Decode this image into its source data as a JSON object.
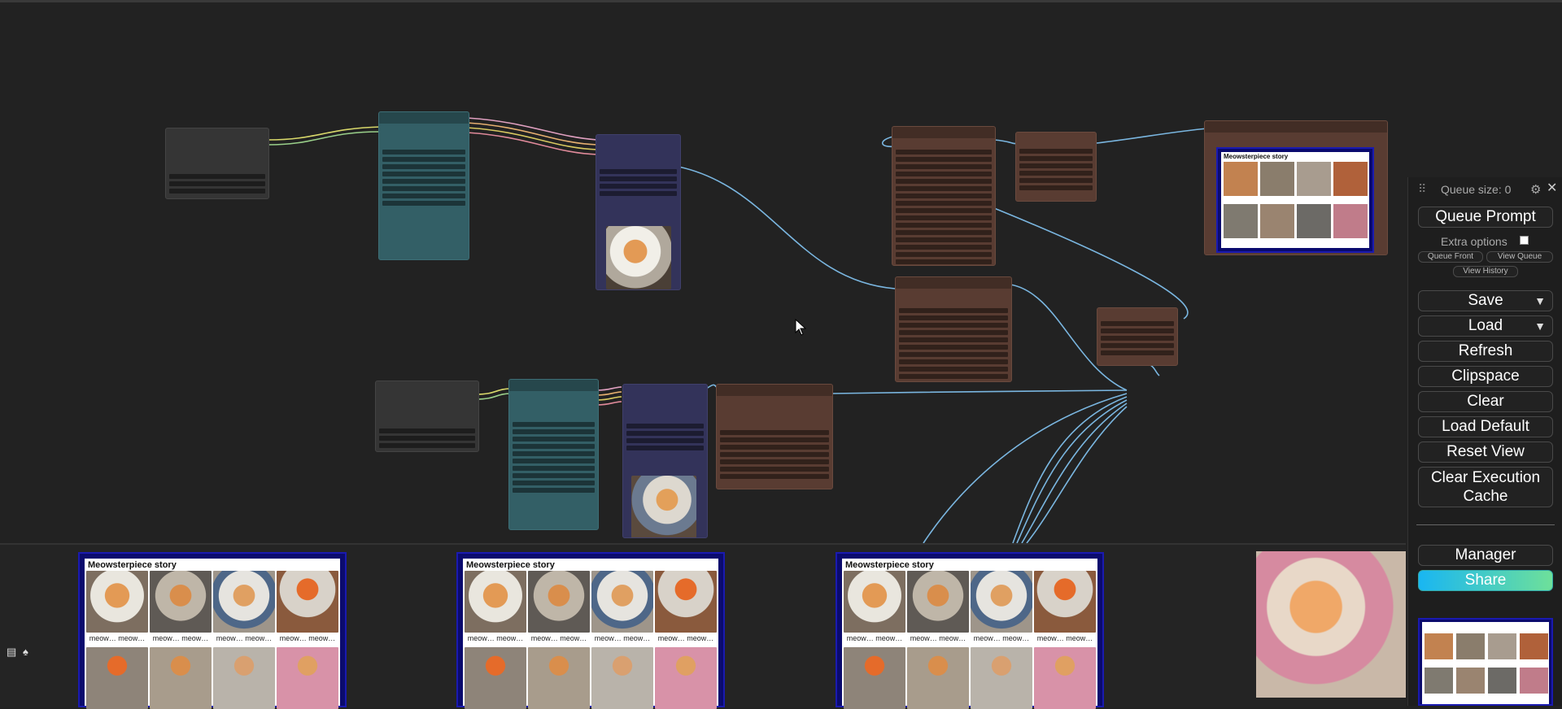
{
  "queue": {
    "size_label": "Queue size: 0",
    "extra_options_label": "Extra options",
    "extra_options_checked": false
  },
  "buttons": {
    "queue_prompt": "Queue Prompt",
    "queue_front": "Queue Front",
    "view_queue": "View Queue",
    "view_history": "View History",
    "save": "Save",
    "load": "Load",
    "refresh": "Refresh",
    "clipspace": "Clipspace",
    "clear": "Clear",
    "load_default": "Load Default",
    "reset_view": "Reset View",
    "clear_execution_cache": "Clear Execution Cache",
    "manager": "Manager",
    "share": "Share"
  },
  "gallery": {
    "cards": [
      {
        "title": "Meowsterpiece story",
        "captions": [
          "meow… meow…",
          "meow… meow…",
          "meow… meow…",
          "meow… meow…"
        ]
      },
      {
        "title": "Meowsterpiece story",
        "captions": [
          "meow… meow…",
          "meow… meow…",
          "meow… meow…",
          "meow… meow…"
        ]
      },
      {
        "title": "Meowsterpiece story",
        "captions": [
          "meow… meow…",
          "meow… meow…",
          "meow… meow…",
          "meow… meow…"
        ]
      }
    ]
  },
  "canvas_preview": {
    "title": "Meowsterpiece story"
  },
  "colors": {
    "background": "#222222",
    "node_gray": "#353535",
    "node_teal": "#335f66",
    "node_navy": "#33335a",
    "node_brown": "#593c32",
    "link_blue": "#7ab6e0",
    "gallery_frame": "#0b0b6e",
    "share_gradient_start": "#19b6f2",
    "share_gradient_end": "#6ee09a"
  }
}
